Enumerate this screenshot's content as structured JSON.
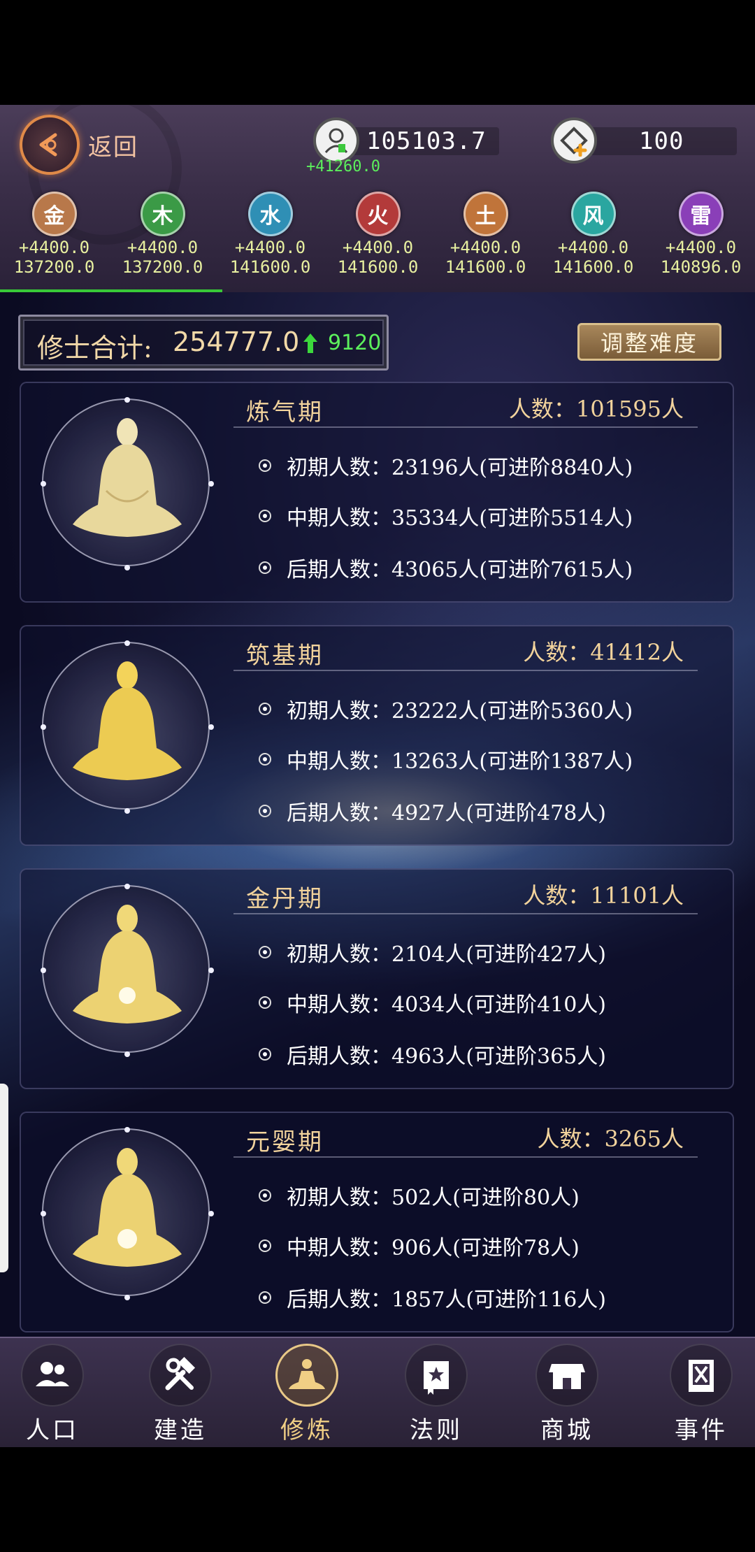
{
  "header": {
    "back_label": "返回",
    "population": {
      "value": "105103.7",
      "delta": "+41260.0"
    },
    "currency": {
      "value": "100"
    }
  },
  "elements": [
    {
      "name": "金",
      "rate": "+4400.0",
      "total": "137200.0",
      "color": "#b8784a"
    },
    {
      "name": "木",
      "rate": "+4400.0",
      "total": "137200.0",
      "color": "#3b9a46"
    },
    {
      "name": "水",
      "rate": "+4400.0",
      "total": "141600.0",
      "color": "#2f8fb5"
    },
    {
      "name": "火",
      "rate": "+4400.0",
      "total": "141600.0",
      "color": "#b33a3a"
    },
    {
      "name": "土",
      "rate": "+4400.0",
      "total": "141600.0",
      "color": "#c0743a"
    },
    {
      "name": "风",
      "rate": "+4400.0",
      "total": "141600.0",
      "color": "#2aa6a0"
    },
    {
      "name": "雷",
      "rate": "+4400.0",
      "total": "140896.0",
      "color": "#8a3fb8"
    }
  ],
  "summary": {
    "label": "修士合计:",
    "total": "254777.0",
    "delta": "9120",
    "adjust_button": "调整难度"
  },
  "stages": [
    {
      "title": "炼气期",
      "count": "人数：101595人",
      "rows": [
        "初期人数：23196人(可进阶8840人)",
        "中期人数：35334人(可进阶5514人)",
        "后期人数：43065人(可进阶7615人)"
      ]
    },
    {
      "title": "筑基期",
      "count": "人数：41412人",
      "rows": [
        "初期人数：23222人(可进阶5360人)",
        "中期人数：13263人(可进阶1387人)",
        "后期人数：4927人(可进阶478人)"
      ]
    },
    {
      "title": "金丹期",
      "count": "人数：11101人",
      "rows": [
        "初期人数：2104人(可进阶427人)",
        "中期人数：4034人(可进阶410人)",
        "后期人数：4963人(可进阶365人)"
      ]
    },
    {
      "title": "元婴期",
      "count": "人数：3265人",
      "rows": [
        "初期人数：502人(可进阶80人)",
        "中期人数：906人(可进阶78人)",
        "后期人数：1857人(可进阶116人)"
      ]
    }
  ],
  "nav": [
    {
      "label": "人口",
      "icon": "people-icon"
    },
    {
      "label": "建造",
      "icon": "build-tools-icon"
    },
    {
      "label": "修炼",
      "icon": "meditation-icon",
      "active": true
    },
    {
      "label": "法则",
      "icon": "rules-book-icon"
    },
    {
      "label": "商城",
      "icon": "shop-icon"
    },
    {
      "label": "事件",
      "icon": "event-book-icon"
    }
  ],
  "colors": {
    "accent_gold": "#f2d39c",
    "positive_green": "#5cf05c"
  }
}
